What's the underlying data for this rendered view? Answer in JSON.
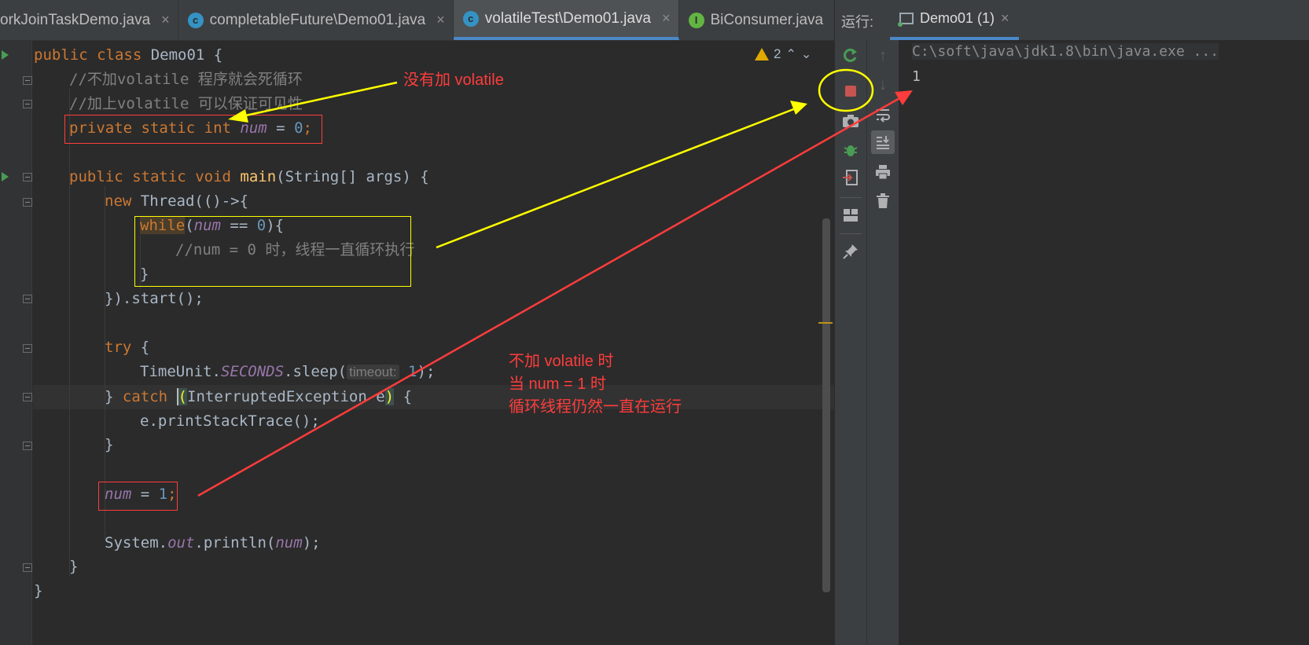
{
  "tabs": [
    {
      "label": "orkJoinTaskDemo.java",
      "icon": "java-class-icon",
      "active": false
    },
    {
      "label": "completableFuture\\Demo01.java",
      "icon": "java-class-icon",
      "active": false
    },
    {
      "label": "volatileTest\\Demo01.java",
      "icon": "java-class-icon",
      "active": true
    },
    {
      "label": "BiConsumer.java",
      "icon": "java-interface-icon",
      "active": false
    }
  ],
  "tab_close_glyph": "×",
  "editor": {
    "warnings_count": "2",
    "code": {
      "public": "public",
      "class": "class",
      "classname": " Demo01 {",
      "comment1": "//不加volatile 程序就会死循环",
      "comment2": "//加上volatile 可以保证可见性",
      "private": "private",
      "static": "static",
      "int": "int",
      "void": "void",
      "num": "num",
      "eq0": " = ",
      "zero": "0",
      "semi": ";",
      "main": "main",
      "main_args": "(String[] args) {",
      "new": "new",
      "thread": " Thread(()->{",
      "while": "while",
      "open_paren": "(",
      "eqeq": " == ",
      "close_brace_paren": "){",
      "comment3": "//num = 0 时，线程一直循环执行",
      "close_brace": "}",
      "start": "}).start();",
      "try": "try",
      "open_brace": " {",
      "timeunit": "TimeUnit.",
      "seconds": "SECONDS",
      "sleep": ".sleep(",
      "timeout_hint": "timeout:",
      "one": "1",
      "sleep_end": ");",
      "close_catch": "} ",
      "catch": "catch",
      "lparen": "(",
      "exception": "InterruptedException e",
      "rparen": ")",
      "print_stack": "e.printStackTrace();",
      "assign": " = ",
      "system": "System.",
      "out": "out",
      "println": ".println(",
      "println_end": ");"
    }
  },
  "run_panel": {
    "label": "运行:",
    "tab_label": "Demo01 (1)",
    "console_lines": [
      "C:\\soft\\java\\jdk1.8\\bin\\java.exe ...",
      "1"
    ]
  },
  "annotations": {
    "no_volatile": "没有加 volatile",
    "note_line1": "不加 volatile 时",
    "note_line2": "当 num = 1 时",
    "note_line3": "循环线程仍然一直在运行"
  },
  "colors": {
    "annotation_red": "#ff3c3c",
    "annotation_yellow": "#ffff00",
    "active_tab_underline": "#4a88c7",
    "run_icon_green": "#499c54",
    "stop_icon_red": "#c75450"
  }
}
